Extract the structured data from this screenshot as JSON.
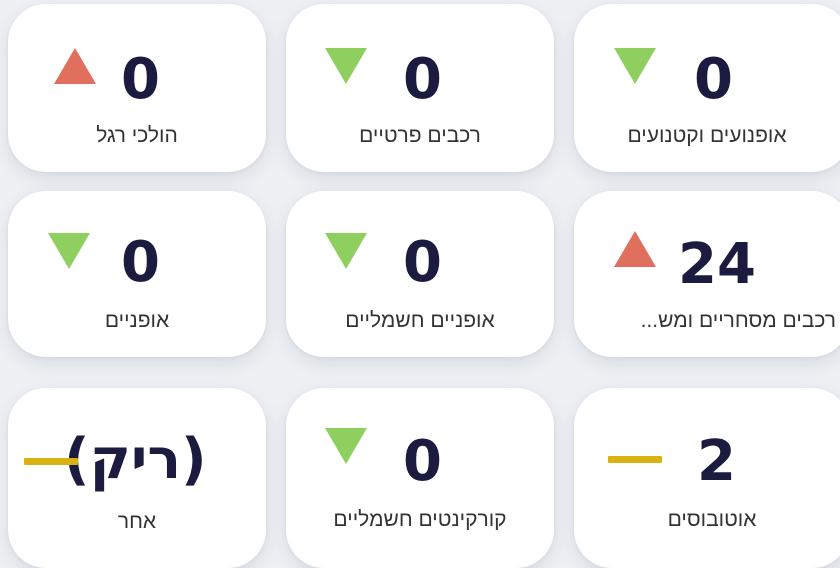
{
  "colors": {
    "up": "#e06f5d",
    "down": "#8fcf5f",
    "neutral": "#d8b210",
    "value_text": "#1b1a3f",
    "card_bg": "#ffffff",
    "page_bg": "#eef1f4"
  },
  "cards": [
    {
      "label": "הולכי רגל",
      "value": "0",
      "trend": "up-triangle-icon"
    },
    {
      "label": "רכבים פרטיים",
      "value": "0",
      "trend": "down-triangle-icon"
    },
    {
      "label": "אופנועים וקטנועים",
      "value": "0",
      "trend": "down-triangle-icon"
    },
    {
      "label": "אופניים",
      "value": "0",
      "trend": "down-triangle-icon"
    },
    {
      "label": "אופניים חשמליים",
      "value": "0",
      "trend": "down-triangle-icon"
    },
    {
      "label": "רכבים מסחריים ומש...",
      "value": "24",
      "trend": "up-triangle-icon"
    },
    {
      "label": "אחר",
      "value": "(ריק)",
      "trend": "dash-icon"
    },
    {
      "label": "קורקינטים חשמליים",
      "value": "0",
      "trend": "down-triangle-icon"
    },
    {
      "label": "אוטובוסים",
      "value": "2",
      "trend": "dash-icon"
    }
  ]
}
